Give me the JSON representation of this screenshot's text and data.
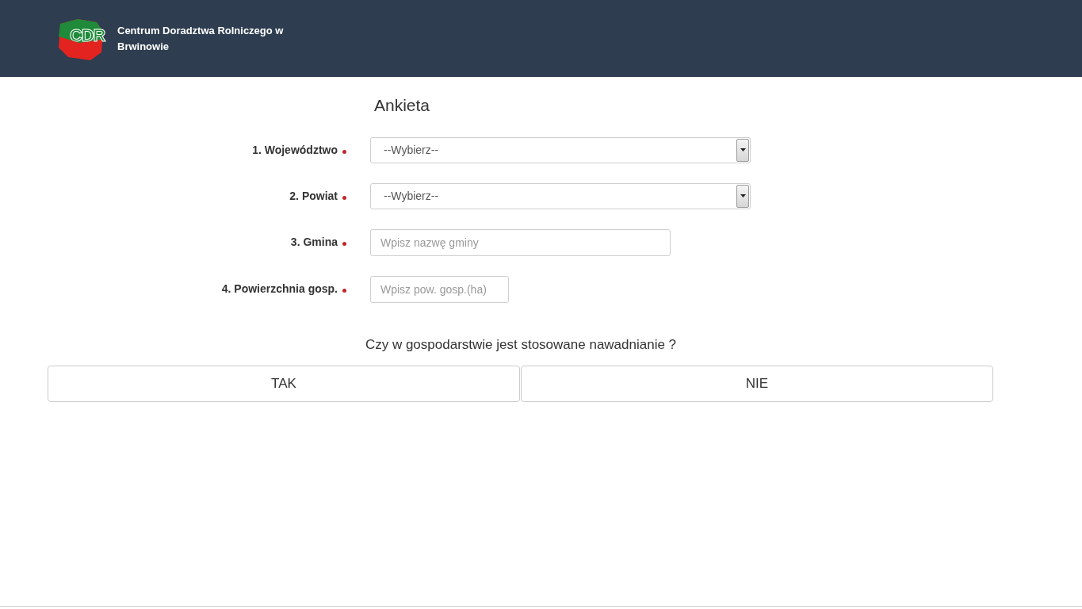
{
  "header": {
    "logo_text": "CDR",
    "title": "Centrum Doradztwa Rolniczego w Brwinowie"
  },
  "form": {
    "title": "Ankieta",
    "fields": [
      {
        "kind": "select",
        "label": "1. Województwo",
        "required": true,
        "value": "--Wybierz--"
      },
      {
        "kind": "select",
        "label": "2. Powiat",
        "required": true,
        "value": "--Wybierz--"
      },
      {
        "kind": "text",
        "label": "3. Gmina",
        "required": true,
        "placeholder": "Wpisz nazwę gminy"
      },
      {
        "kind": "text",
        "label": "4. Powierzchnia gosp.",
        "required": true,
        "placeholder": "Wpisz pow. gosp.(ha)"
      }
    ]
  },
  "question": {
    "text": "Czy w gospodarstwie jest stosowane nawadnianie ?",
    "answers": [
      "TAK",
      "NIE"
    ]
  }
}
